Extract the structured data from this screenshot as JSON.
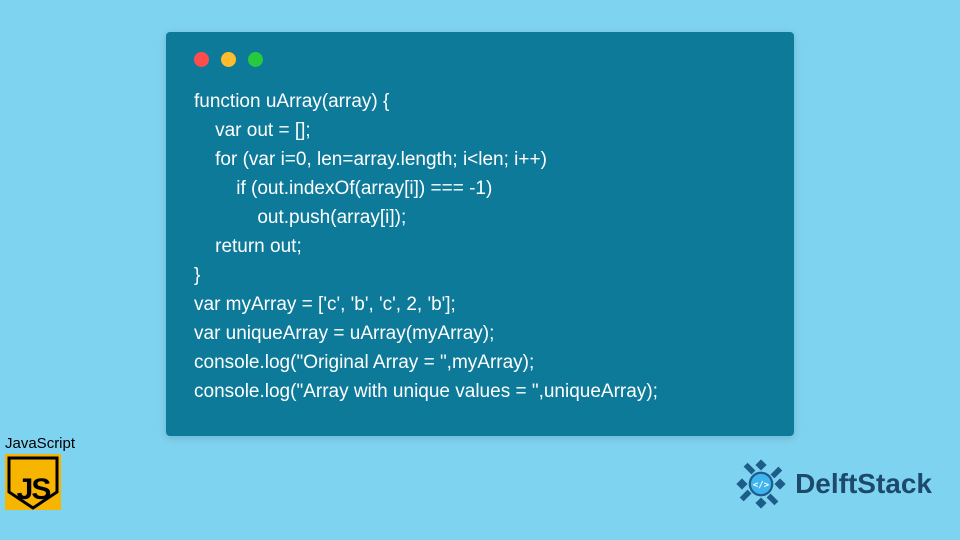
{
  "code": {
    "lines": [
      "function uArray(array) {",
      "    var out = [];",
      "    for (var i=0, len=array.length; i<len; i++)",
      "        if (out.indexOf(array[i]) === -1)",
      "            out.push(array[i]);",
      "    return out;",
      "}",
      "var myArray = ['c', 'b', 'c', 2, 'b'];",
      "var uniqueArray = uArray(myArray);",
      "console.log(\"Original Array = \",myArray);",
      "console.log(\"Array with unique values = \",uniqueArray);"
    ]
  },
  "badges": {
    "javascript_label": "JavaScript",
    "javascript_short": "JS"
  },
  "brand": {
    "name": "DelftStack"
  },
  "colors": {
    "page_bg": "#7ed3f0",
    "window_bg": "#0e7a9a",
    "code_text": "#ffffff",
    "js_yellow": "#f7b500",
    "brand_blue": "#1d4a6a"
  }
}
